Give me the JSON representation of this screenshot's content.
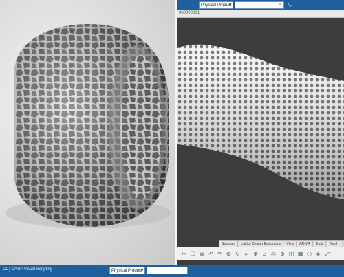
{
  "top": {
    "product_selector": "Physical Product",
    "search_placeholder": "",
    "object_id": "000000001"
  },
  "tabs": [
    "Standard",
    "Lattice Design Exploration",
    "View",
    "AR-VR",
    "Tools",
    "Touch"
  ],
  "toolbar_icons": [
    "cut-icon",
    "copy-icon",
    "paste-icon",
    "undo-icon",
    "redo-icon",
    "settings-icon",
    "update-icon",
    "select-icon",
    "move-icon",
    "measure-icon",
    "snap-icon",
    "zoom-icon",
    "view-icon",
    "grid-icon",
    "lattice-icon",
    "render-icon",
    "expand-icon"
  ],
  "bottom": {
    "brand": "CL | CATIA Visual Scripting",
    "product_selector": "Physical Product"
  }
}
